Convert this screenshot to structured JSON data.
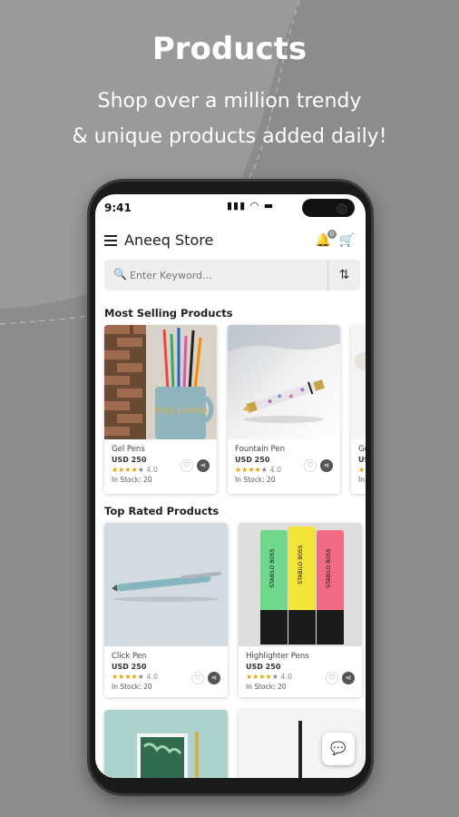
{
  "promo": {
    "title": "Products",
    "subtitle_line1": "Shop over a million trendy",
    "subtitle_line2": "& unique products added daily!"
  },
  "status": {
    "time": "9:41",
    "icons": "▮▮▮  ◔  ▬"
  },
  "appbar": {
    "store_name": "Aneeq Store",
    "notification_count": "0"
  },
  "search": {
    "placeholder": "Enter Keyword..."
  },
  "sections": {
    "most_selling": "Most Selling Products",
    "top_rated": "Top Rated Products"
  },
  "most_selling": [
    {
      "name": "Gel Pens",
      "price": "USD 250",
      "rating_stars": "★★★★",
      "rating_empty": "★",
      "rating_value": "4.0",
      "stock": "In Stock: 20"
    },
    {
      "name": "Fountain Pen",
      "price": "USD 250",
      "rating_stars": "★★★★",
      "rating_empty": "★",
      "rating_value": "4.0",
      "stock": "In Stock: 20"
    },
    {
      "name": "Go",
      "price": "USD",
      "rating_stars": "★★",
      "stock": "In St"
    }
  ],
  "top_rated": [
    {
      "name": "Click Pen",
      "price": "USD 250",
      "rating_stars": "★★★★",
      "rating_empty": "★",
      "rating_value": "4.0",
      "stock": "In Stock: 20"
    },
    {
      "name": "Highlighter Pens",
      "price": "USD 250",
      "rating_stars": "★★★★",
      "rating_empty": "★",
      "rating_value": "4.0",
      "stock": "In Stock: 20"
    }
  ],
  "highlighter_labels": [
    "STABILO BOSS",
    "STABILO BOSS",
    "STABILO BOSS"
  ],
  "mug_text": "Stay Lovely",
  "icons": {
    "menu": "menu-icon",
    "bell": "bell-icon",
    "cart": "cart-icon",
    "search": "search-icon",
    "filter": "filter-icon",
    "heart": "heart-icon",
    "share": "share-icon",
    "chat": "chat-icon"
  },
  "colors": {
    "background": "#8c8c8c",
    "star": "#e0a500",
    "accent_dark": "#555555"
  }
}
